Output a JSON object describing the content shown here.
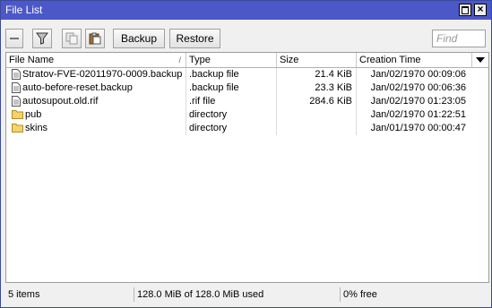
{
  "window": {
    "title": "File List"
  },
  "toolbar": {
    "remove_icon": "minus-icon",
    "filter_icon": "filter-icon",
    "copy_icon": "copy-icon",
    "paste_icon": "paste-icon",
    "backup_label": "Backup",
    "restore_label": "Restore",
    "find_placeholder": "Find"
  },
  "table": {
    "columns": [
      "File Name",
      "Type",
      "Size",
      "Creation Time"
    ],
    "sorted_column": "File Name",
    "rows": [
      {
        "icon": "file-icon",
        "name": "Stratov-FVE-02011970-0009.backup",
        "type": ".backup file",
        "size": "21.4 KiB",
        "created": "Jan/02/1970 00:09:06"
      },
      {
        "icon": "file-icon",
        "name": "auto-before-reset.backup",
        "type": ".backup file",
        "size": "23.3 KiB",
        "created": "Jan/02/1970 00:06:36"
      },
      {
        "icon": "file-icon",
        "name": "autosupout.old.rif",
        "type": ".rif file",
        "size": "284.6 KiB",
        "created": "Jan/02/1970 01:23:05"
      },
      {
        "icon": "folder-icon",
        "name": "pub",
        "type": "directory",
        "size": "",
        "created": "Jan/02/1970 01:22:51"
      },
      {
        "icon": "folder-icon",
        "name": "skins",
        "type": "directory",
        "size": "",
        "created": "Jan/01/1970 00:00:47"
      }
    ]
  },
  "status": {
    "items": "5 items",
    "usage": "128.0 MiB of 128.0 MiB used",
    "free": "0% free"
  },
  "colors": {
    "titlebar": "#4c57c8",
    "folder": "#f3d36b"
  }
}
